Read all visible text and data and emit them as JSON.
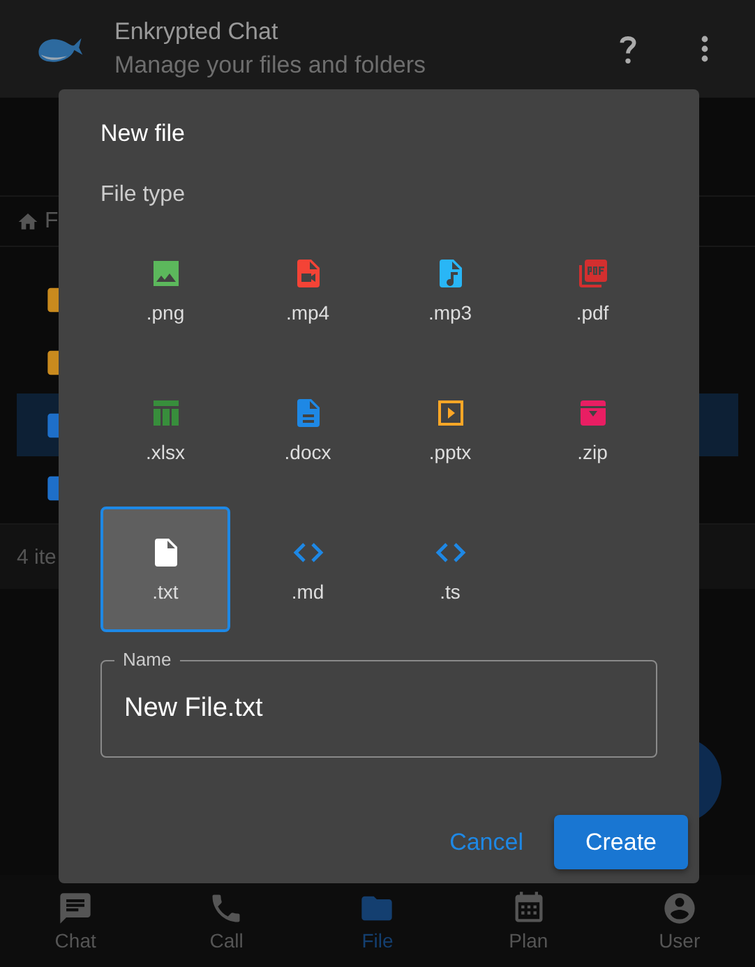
{
  "app_bar": {
    "title": "Enkrypted Chat",
    "subtitle": "Manage your files and folders"
  },
  "breadcrumb": {
    "label": "F"
  },
  "folders": [
    {
      "color": "#c98a1e",
      "selected": false
    },
    {
      "color": "#c98a1e",
      "selected": false
    },
    {
      "color": "#1e6fc9",
      "selected": true
    },
    {
      "color": "#1e6fc9",
      "selected": false
    }
  ],
  "status_bar": {
    "text": "4 ite"
  },
  "dialog": {
    "title": "New file",
    "section_label": "File type",
    "file_types": [
      {
        "label": ".png",
        "kind": "image",
        "color": "#5cb85c",
        "selected": false
      },
      {
        "label": ".mp4",
        "kind": "video",
        "color": "#f44336",
        "selected": false
      },
      {
        "label": ".mp3",
        "kind": "audio",
        "color": "#29b6f6",
        "selected": false
      },
      {
        "label": ".pdf",
        "kind": "pdf",
        "color": "#d32f2f",
        "selected": false
      },
      {
        "label": ".xlsx",
        "kind": "sheet",
        "color": "#388e3c",
        "selected": false
      },
      {
        "label": ".docx",
        "kind": "doc",
        "color": "#1e88e5",
        "selected": false
      },
      {
        "label": ".pptx",
        "kind": "slides",
        "color": "#ffa726",
        "selected": false
      },
      {
        "label": ".zip",
        "kind": "archive",
        "color": "#e91e63",
        "selected": false
      },
      {
        "label": ".txt",
        "kind": "text",
        "color": "#ffffff",
        "selected": true
      },
      {
        "label": ".md",
        "kind": "code",
        "color": "#1e88e5",
        "selected": false
      },
      {
        "label": ".ts",
        "kind": "code",
        "color": "#1e88e5",
        "selected": false
      }
    ],
    "name_field": {
      "label": "Name",
      "value": "New File.txt"
    },
    "buttons": [
      {
        "label": "Cancel",
        "kind": "text"
      },
      {
        "label": "Create",
        "kind": "primary"
      }
    ]
  },
  "bottom_nav": [
    {
      "label": "Chat",
      "kind": "chat",
      "selected": false
    },
    {
      "label": "Call",
      "kind": "call",
      "selected": false
    },
    {
      "label": "File",
      "kind": "file",
      "selected": true
    },
    {
      "label": "Plan",
      "kind": "plan",
      "selected": false
    },
    {
      "label": "User",
      "kind": "user",
      "selected": false
    }
  ]
}
